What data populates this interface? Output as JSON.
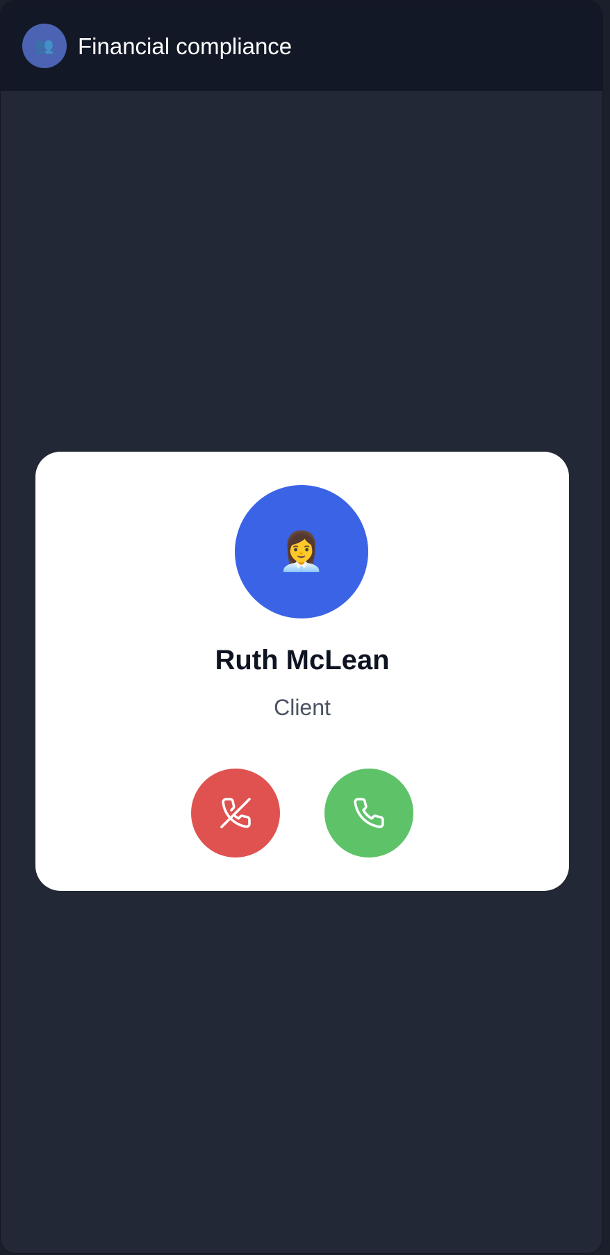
{
  "header": {
    "avatar_icon": "👥",
    "title": "Financial compliance"
  },
  "call": {
    "avatar_emoji": "👩‍💼",
    "caller_name": "Ruth McLean",
    "caller_role": "Client",
    "decline_icon": "phone-off-icon",
    "accept_icon": "phone-icon"
  },
  "colors": {
    "accent": "#3a63e6",
    "decline": "#df5250",
    "accept": "#5ec269",
    "header_bg": "#131826",
    "page_bg": "#222835"
  }
}
